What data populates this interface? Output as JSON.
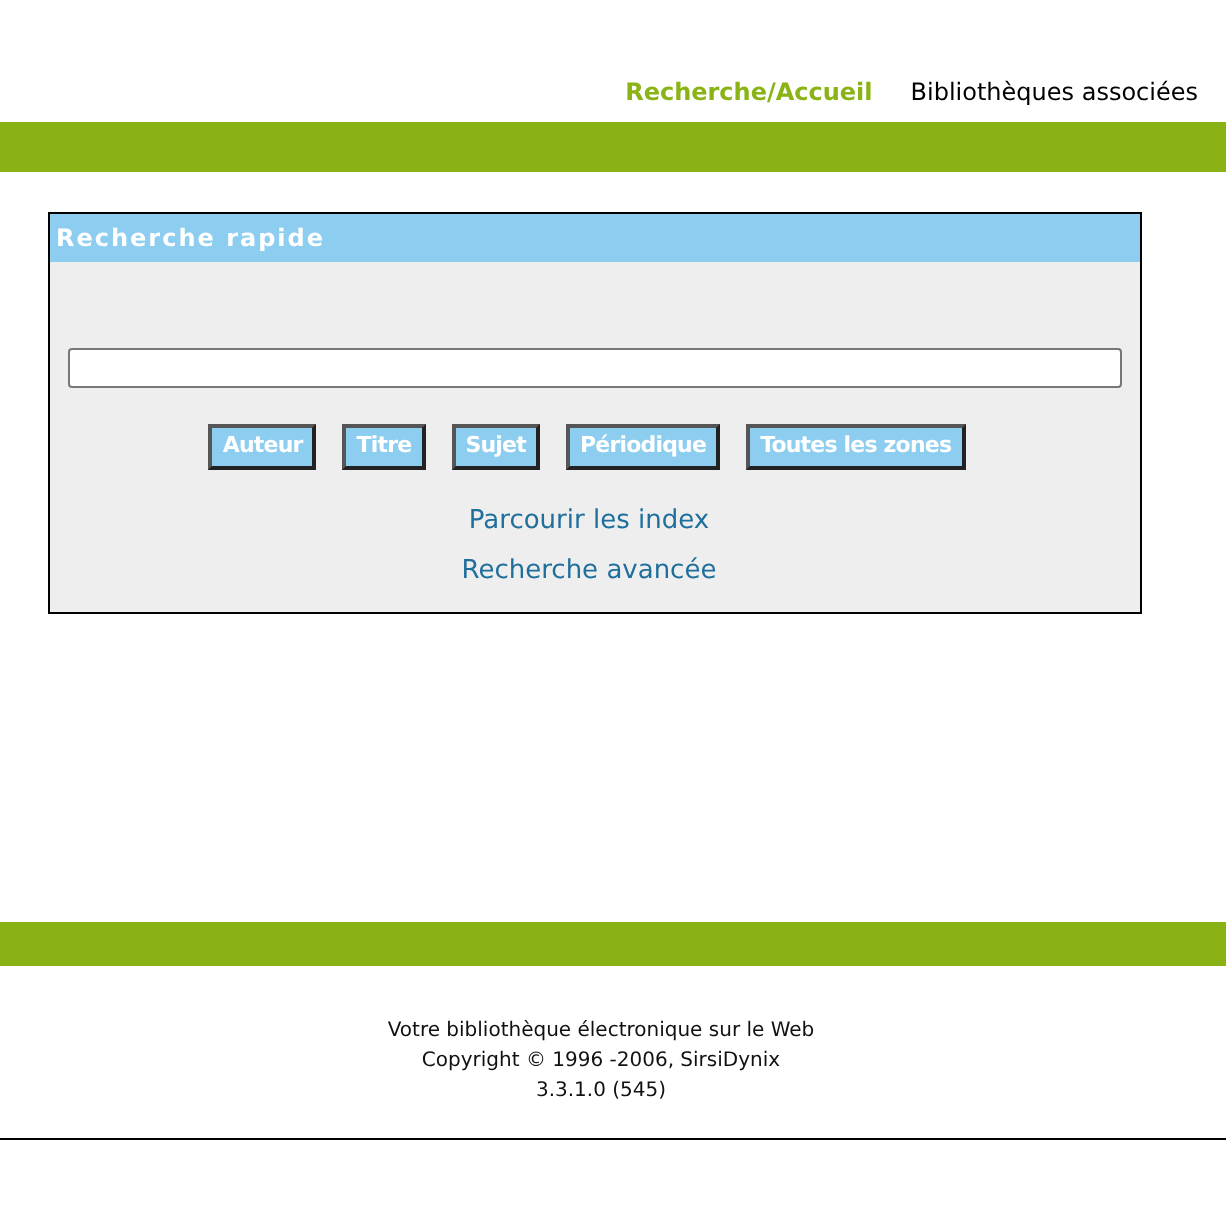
{
  "nav": [
    {
      "label": "Recherche/Accueil",
      "selected": true
    },
    {
      "label": "Bibliothèques associées",
      "selected": false
    }
  ],
  "quick_search": {
    "title": "Recherche rapide",
    "buttons": [
      "Auteur",
      "Titre",
      "Sujet",
      "Périodique",
      "Toutes les zones"
    ],
    "links": [
      "Parcourir les index",
      "Recherche avancée"
    ]
  },
  "footer": {
    "lines": [
      "Votre bibliothèque électronique sur le Web",
      "Copyright © 1996 -2006, SirsiDynix",
      "3.3.1.0 (545)"
    ]
  }
}
